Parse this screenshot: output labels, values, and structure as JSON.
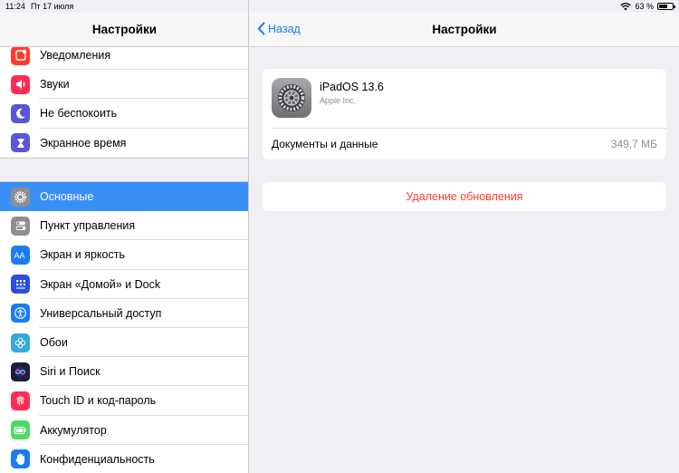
{
  "status": {
    "time": "11:24",
    "date": "Пт 17 июля",
    "battery": "63 %",
    "battery_level": 0.63
  },
  "sidebar": {
    "title": "Настройки",
    "group1": [
      {
        "label": "Уведомления",
        "icon": "notifications-icon",
        "color": "#ff3b30"
      },
      {
        "label": "Звуки",
        "icon": "sounds-icon",
        "color": "#ff2d55"
      },
      {
        "label": "Не беспокоить",
        "icon": "moon-icon",
        "color": "#5856d6"
      },
      {
        "label": "Экранное время",
        "icon": "hourglass-icon",
        "color": "#5856d6"
      }
    ],
    "group2": [
      {
        "label": "Основные",
        "icon": "gear-icon",
        "color": "#8e8e93",
        "selected": true
      },
      {
        "label": "Пункт управления",
        "icon": "control-center-icon",
        "color": "#8e8e93"
      },
      {
        "label": "Экран и яркость",
        "icon": "display-icon",
        "color": "#1a7cf5"
      },
      {
        "label": "Экран «Домой» и Dock",
        "icon": "home-grid-icon",
        "color": "#2d4ce0"
      },
      {
        "label": "Универсальный доступ",
        "icon": "accessibility-icon",
        "color": "#1a7cf5"
      },
      {
        "label": "Обои",
        "icon": "wallpaper-icon",
        "color": "#34aadc"
      },
      {
        "label": "Siri и Поиск",
        "icon": "siri-icon",
        "color": "#1c1c3c"
      },
      {
        "label": "Touch ID и код-пароль",
        "icon": "fingerprint-icon",
        "color": "#ff2d55"
      },
      {
        "label": "Аккумулятор",
        "icon": "battery-icon",
        "color": "#4cd964"
      },
      {
        "label": "Конфиденциальность",
        "icon": "hand-icon",
        "color": "#1a7cf5"
      }
    ]
  },
  "detail": {
    "back_label": "Назад",
    "title": "Настройки",
    "update_name": "iPadOS 13.6",
    "update_vendor": "Apple Inc.",
    "docs_label": "Документы и данные",
    "docs_value": "349,7 МБ",
    "delete_label": "Удаление обновления"
  }
}
